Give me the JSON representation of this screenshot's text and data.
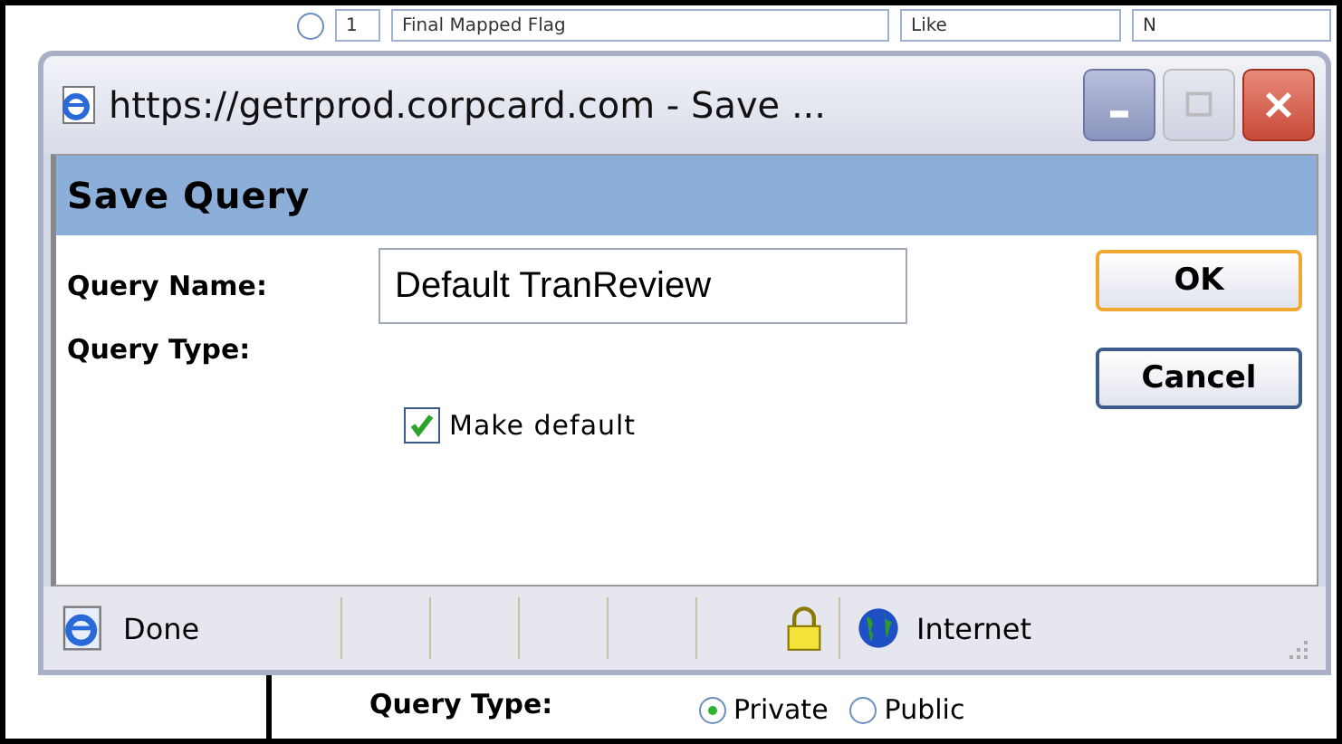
{
  "background_page": {
    "criteria_row": {
      "selected": false,
      "number": "1",
      "field": "Final Mapped Flag",
      "operator": "Like",
      "value": "N"
    },
    "query_type": {
      "label": "Query Type:",
      "options": [
        {
          "label": "Private",
          "selected": true
        },
        {
          "label": "Public",
          "selected": false
        }
      ]
    }
  },
  "popup": {
    "title": "https://getrprod.corpcard.com - Save ...",
    "heading": "Save Query",
    "query_name": {
      "label": "Query Name:",
      "value": "Default TranReview"
    },
    "query_type": {
      "label": "Query Type:"
    },
    "make_default": {
      "label": "Make default",
      "checked": true
    },
    "buttons": [
      {
        "label": "OK",
        "focused": true
      },
      {
        "label": "Cancel",
        "focused": false
      }
    ],
    "status_bar": {
      "status": "Done",
      "zone": "Internet"
    }
  }
}
